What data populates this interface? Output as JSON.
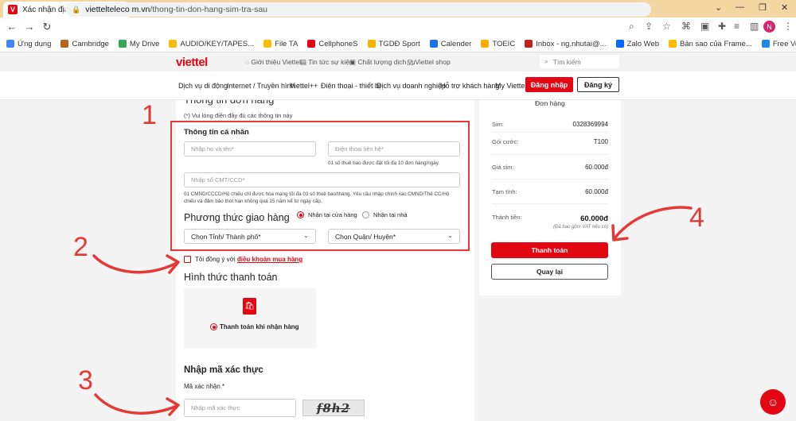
{
  "browser": {
    "tab_title": "Xác nhận địa chỉ nhận sim Viettel",
    "tab_favicon": "V",
    "new_tab": "+",
    "url_domain": "viettelteleco m.vn",
    "url_full_domain": "viettelteleco m.vn",
    "url_path": "/thong-tin-don-hang-sim-tra-sau",
    "profile_initial": "N",
    "bookmarks": [
      "Ứng dụng",
      "Cambridge",
      "My Drive",
      "AUDIO/KEY/TAPES...",
      "File TA",
      "CellphoneS",
      "TGDĐ Sport",
      "Calender",
      "TOEIC",
      "Inbox - ng.nhutai@...",
      "Zalo Web",
      "Bản sao của Frame...",
      "Free Vectors, Stock..."
    ]
  },
  "site": {
    "logo": "viettel",
    "top_links": [
      "Giới thiệu Viettel",
      "Tin tức sự kiện",
      "Chất lượng dịch vụ",
      "Viettel shop"
    ],
    "search_placeholder": "Tìm kiếm",
    "nav": [
      "Dịch vụ di động",
      "Internet / Truyền hình",
      "Viettel++",
      "Điện thoại - thiết bị",
      "Dịch vụ doanh nghiệp",
      "Hỗ trợ khách hàng",
      "My Viettel"
    ],
    "login": "Đăng nhập",
    "register": "Đăng ký"
  },
  "form": {
    "title": "Thông tin đơn hàng",
    "note": "(*) Vui lòng điền đầy đủ các thông tin này",
    "personal_heading": "Thông tin cá nhân",
    "name_placeholder": "Nhập họ và tên*",
    "phone_placeholder": "Điện thoại liên hệ*",
    "phone_hint": "01 số thuê bao được đặt tối đa 10 đơn hàng/ngày.",
    "id_placeholder": "Nhập số CMT/CCD*",
    "id_hint": "01 CMND/CCCD/Hộ chiếu chỉ được hòa mạng tối đa 03 số thuê bao/tháng. Yêu cầu nhập chính xác CMND/Thẻ CC/Hộ chiếu và đảm bảo thời hạn không quá 15 năm kể từ ngày cấp.",
    "shipping_heading": "Phương thức giao hàng",
    "ship_option_store": "Nhận tại cửa hàng",
    "ship_option_home": "Nhận tại nhà",
    "province_select": "Chọn Tỉnh/ Thành phố*",
    "district_select": "Chọn Quận/ Huyện*",
    "agree_text": "Tôi đồng ý với",
    "agree_link": "điều khoản mua hàng",
    "payment_heading": "Hình thức thanh toán",
    "payment_option": "Thanh toán khi nhận hàng",
    "captcha_heading": "Nhập mã xác thực",
    "captcha_label": "Mã xác nhận *",
    "captcha_placeholder": "Nhập mã xác thực",
    "captcha_text": "f8h2"
  },
  "summary": {
    "title": "Đơn hàng",
    "rows": [
      {
        "label": "Sim:",
        "value": "0328369994"
      },
      {
        "label": "Gói cước:",
        "value": "T100"
      },
      {
        "label": "Giá sim:",
        "value": "60.000đ"
      },
      {
        "label": "Tạm tính:",
        "value": "60.000đ"
      },
      {
        "label": "Thành tiền:",
        "value": "60.000đ"
      }
    ],
    "vat_note": "(Đã bao gồm VAT nếu có)",
    "pay_button": "Thanh toán",
    "back_button": "Quay lại"
  },
  "annotations": [
    "1",
    "2",
    "3",
    "4"
  ],
  "colors": {
    "brand": "#e30613",
    "annotation": "#e53935"
  }
}
